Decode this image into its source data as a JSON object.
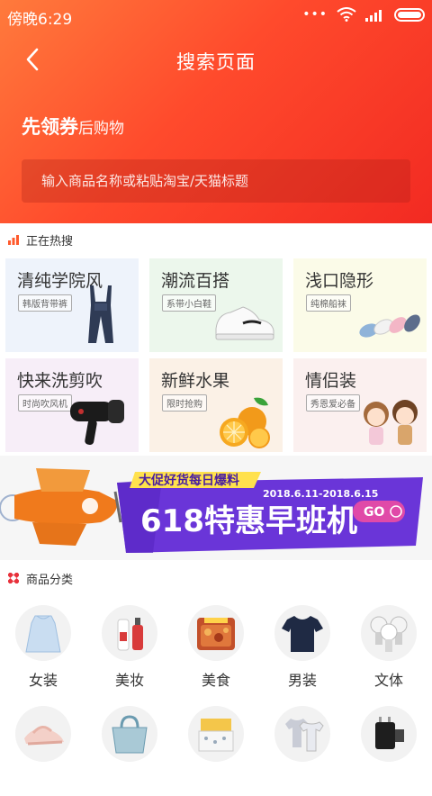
{
  "status_bar": {
    "time": "傍晚6:29",
    "dots": "•••"
  },
  "nav": {
    "title": "搜索页面"
  },
  "promo": {
    "strong": "先领券",
    "weak": "后购物"
  },
  "search": {
    "placeholder": "输入商品名称或粘贴淘宝/天猫标题"
  },
  "hot": {
    "label": "正在热搜",
    "items": [
      {
        "title": "清纯学院风",
        "tag": "韩版背带裤",
        "bg": "#eef3fb",
        "art": "overalls-icon"
      },
      {
        "title": "潮流百搭",
        "tag": "系带小白鞋",
        "bg": "#ecf7ec",
        "art": "sneaker-icon"
      },
      {
        "title": "浅口隐形",
        "tag": "纯棉船袜",
        "bg": "#fbfbe8",
        "art": "socks-icon"
      },
      {
        "title": "快来洗剪吹",
        "tag": "时尚吹风机",
        "bg": "#f7eef8",
        "art": "hairdryer-icon"
      },
      {
        "title": "新鲜水果",
        "tag": "限时抢购",
        "bg": "#fbf1e6",
        "art": "orange-icon"
      },
      {
        "title": "情侣装",
        "tag": "秀恩爱必备",
        "bg": "#fbf0ef",
        "art": "couple-icon"
      }
    ]
  },
  "banner": {
    "subtitle": "大促好货每日爆料",
    "date": "2018.6.11-2018.6.15",
    "headline": "618特惠早班机",
    "go": "GO"
  },
  "categories": {
    "label": "商品分类",
    "items": [
      {
        "label": "女装",
        "icon": "dress-icon"
      },
      {
        "label": "美妆",
        "icon": "cosmetics-icon"
      },
      {
        "label": "美食",
        "icon": "food-icon"
      },
      {
        "label": "男装",
        "icon": "tshirt-icon"
      },
      {
        "label": "文体",
        "icon": "bulbs-icon"
      },
      {
        "label": "",
        "icon": "sandal-icon"
      },
      {
        "label": "",
        "icon": "handbag-icon"
      },
      {
        "label": "",
        "icon": "bedding-icon"
      },
      {
        "label": "",
        "icon": "baby-clothes-icon"
      },
      {
        "label": "",
        "icon": "charger-icon"
      }
    ]
  },
  "colors": {
    "header_start": "#ff7a3c",
    "header_end": "#f22a22",
    "banner_purple": "#6a35d8",
    "hot_icon": "#ff5a2c",
    "cat_icon": "#e8313b"
  }
}
